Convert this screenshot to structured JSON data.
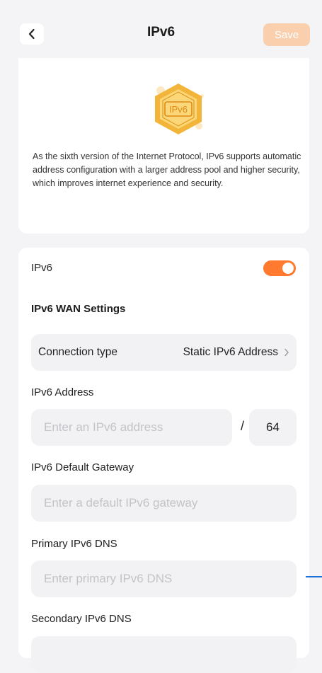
{
  "header": {
    "title": "IPv6",
    "save_label": "Save"
  },
  "intro": {
    "badge_text": "IPv6",
    "description": "As the sixth version of the Internet Protocol, IPv6 supports automatic address configuration with a larger address pool and higher security, which improves internet experience and security."
  },
  "settings": {
    "ipv6_toggle_label": "IPv6",
    "ipv6_enabled": true,
    "wan_section_title": "IPv6 WAN Settings",
    "connection_type_label": "Connection type",
    "connection_type_value": "Static IPv6 Address",
    "address_label": "IPv6 Address",
    "address_placeholder": "Enter an IPv6 address",
    "address_value": "",
    "prefix_separator": "/",
    "prefix_length": "64",
    "gateway_label": "IPv6 Default Gateway",
    "gateway_placeholder": "Enter a default IPv6 gateway",
    "gateway_value": "",
    "primary_dns_label": "Primary IPv6 DNS",
    "primary_dns_placeholder": "Enter primary IPv6 DNS",
    "primary_dns_value": "",
    "secondary_dns_label": "Secondary IPv6 DNS",
    "secondary_dns_value": ""
  },
  "colors": {
    "accent": "#ff7a2e",
    "save_disabled": "#f9cfae",
    "badge_gold": "#f2b53a"
  },
  "icons": {
    "back": "chevron-left-icon",
    "connection_arrow": "chevron-right-icon",
    "badge": "ipv6-hexagon-icon"
  }
}
